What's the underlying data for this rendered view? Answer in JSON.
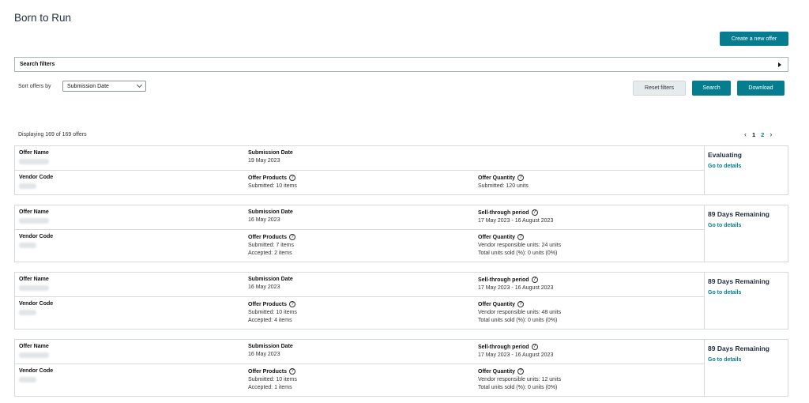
{
  "page": {
    "title": "Born to Run"
  },
  "actions": {
    "create_label": "Create a new offer",
    "reset_label": "Reset filters",
    "search_label": "Search",
    "download_label": "Download"
  },
  "filters": {
    "label": "Search filters"
  },
  "sort": {
    "label": "Sort offers by",
    "value": "Submission Date"
  },
  "list": {
    "displaying": "Displaying 169 of 169 offers",
    "pages": [
      "1",
      "2"
    ],
    "current_page": "1"
  },
  "labels": {
    "offer_name": "Offer Name",
    "vendor_code": "Vendor Code",
    "submission_date": "Submission Date",
    "offer_products": "Offer Products",
    "offer_quantity": "Offer Quantity",
    "sell_through": "Sell-through period",
    "go_to_details": "Go to details"
  },
  "offers": [
    {
      "status": "Evaluating",
      "submission_date": "19 May 2023",
      "products_submitted": "Submitted: 10 items",
      "quantity_submitted": "Submitted: 120 units"
    },
    {
      "status": "89 Days Remaining",
      "submission_date": "16 May 2023",
      "sell_through_period": "17 May 2023 - 16 August 2023",
      "products_submitted": "Submitted: 7 items",
      "products_accepted": "Accepted: 2 items",
      "vendor_units": "Vendor responsible units: 24 units",
      "total_sold": "Total units sold (%): 0 units (0%)"
    },
    {
      "status": "89 Days Remaining",
      "submission_date": "16 May 2023",
      "sell_through_period": "17 May 2023 - 16 August 2023",
      "products_submitted": "Submitted: 10 items",
      "products_accepted": "Accepted: 4 items",
      "vendor_units": "Vendor responsible units: 48 units",
      "total_sold": "Total units sold (%): 0 units (0%)"
    },
    {
      "status": "89 Days Remaining",
      "submission_date": "16 May 2023",
      "sell_through_period": "17 May 2023 - 16 August 2023",
      "products_submitted": "Submitted: 10 items",
      "products_accepted": "Accepted: 1 items",
      "vendor_units": "Vendor responsible units: 12 units",
      "total_sold": "Total units sold (%): 0 units (0%)"
    }
  ],
  "icons": {
    "help": "question-circle-icon",
    "expand": "triangle-right-icon",
    "dropdown": "chevron-down-icon"
  },
  "colors": {
    "accent": "#067d8e",
    "border": "#d5dbdb",
    "title": "#232f3e"
  }
}
